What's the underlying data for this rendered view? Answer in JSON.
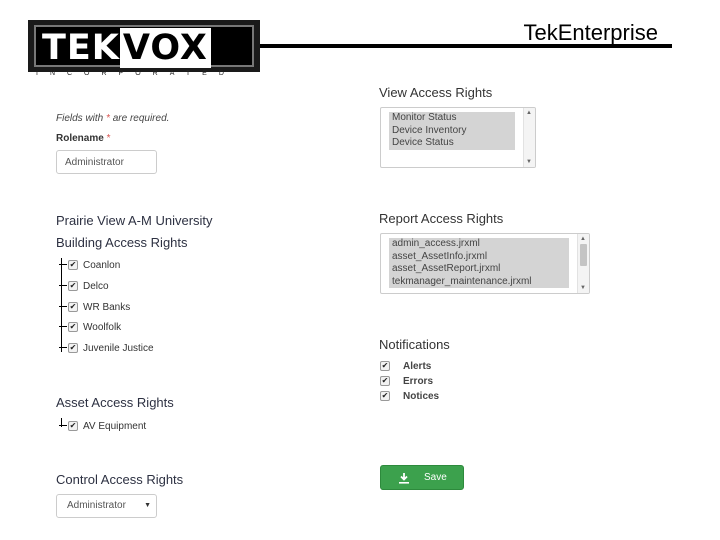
{
  "header": {
    "logo_tek": "TEK",
    "logo_vox": "VOX",
    "logo_sub": "INCORPORATED",
    "app_title": "TekEnterprise"
  },
  "form": {
    "required_note": "Fields with",
    "required_star": "*",
    "required_note_end": "are required.",
    "rolename_label": "Rolename",
    "rolename_star": "*",
    "rolename_value": "Administrator"
  },
  "building": {
    "university": "Prairie View A-M University",
    "title": "Building Access Rights",
    "items": [
      {
        "label": "Coanlon",
        "checked": true
      },
      {
        "label": "Delco",
        "checked": true
      },
      {
        "label": "WR Banks",
        "checked": true
      },
      {
        "label": "Woolfolk",
        "checked": true
      },
      {
        "label": "Juvenile Justice",
        "checked": true
      }
    ]
  },
  "asset": {
    "title": "Asset Access Rights",
    "items": [
      {
        "label": "AV Equipment",
        "checked": true
      }
    ]
  },
  "control": {
    "title": "Control Access Rights",
    "selected": "Administrator"
  },
  "view": {
    "title": "View Access Rights",
    "options": [
      "Monitor Status",
      "Device Inventory",
      "Device Status"
    ]
  },
  "report": {
    "title": "Report Access Rights",
    "options": [
      "admin_access.jrxml",
      "asset_AssetInfo.jrxml",
      "asset_AssetReport.jrxml",
      "tekmanager_maintenance.jrxml"
    ]
  },
  "notifications": {
    "title": "Notifications",
    "items": [
      {
        "label": "Alerts",
        "checked": true
      },
      {
        "label": "Errors",
        "checked": true
      },
      {
        "label": "Notices",
        "checked": true
      }
    ]
  },
  "save_label": "Save",
  "colors": {
    "save_button": "#3ca14d",
    "required": "#d9534f"
  },
  "icons": {
    "save": "download-icon",
    "checkbox": "check-icon",
    "select": "caret-down-icon"
  }
}
